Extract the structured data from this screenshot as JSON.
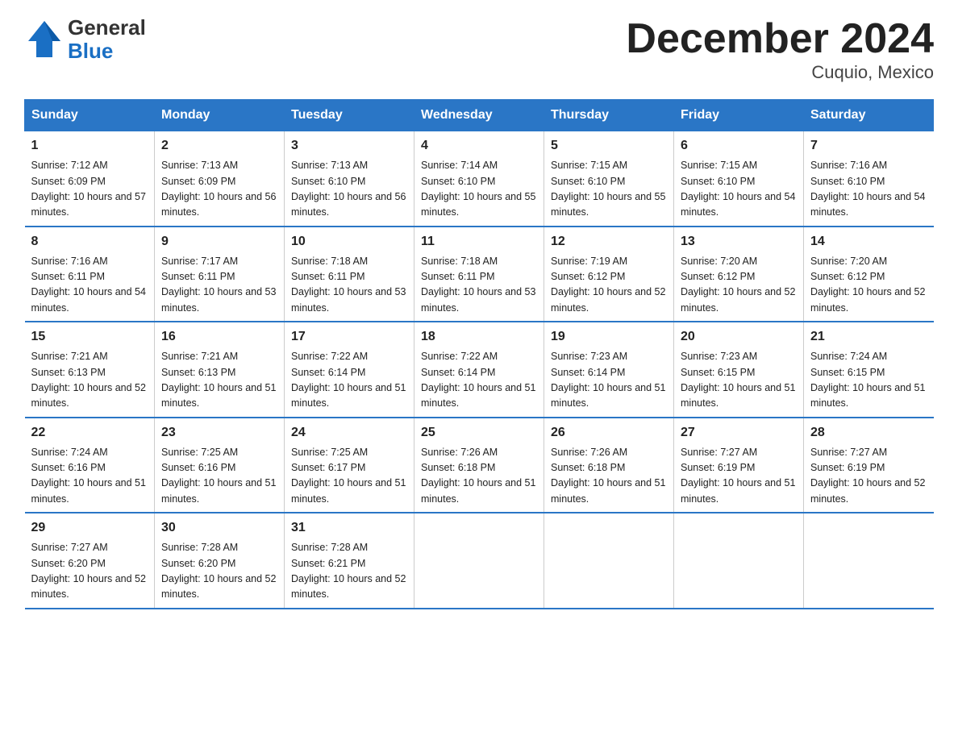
{
  "header": {
    "logo_general": "General",
    "logo_blue": "Blue",
    "title": "December 2024",
    "subtitle": "Cuquio, Mexico"
  },
  "calendar": {
    "days_of_week": [
      "Sunday",
      "Monday",
      "Tuesday",
      "Wednesday",
      "Thursday",
      "Friday",
      "Saturday"
    ],
    "weeks": [
      [
        {
          "day": "1",
          "sunrise": "7:12 AM",
          "sunset": "6:09 PM",
          "daylight": "10 hours and 57 minutes."
        },
        {
          "day": "2",
          "sunrise": "7:13 AM",
          "sunset": "6:09 PM",
          "daylight": "10 hours and 56 minutes."
        },
        {
          "day": "3",
          "sunrise": "7:13 AM",
          "sunset": "6:10 PM",
          "daylight": "10 hours and 56 minutes."
        },
        {
          "day": "4",
          "sunrise": "7:14 AM",
          "sunset": "6:10 PM",
          "daylight": "10 hours and 55 minutes."
        },
        {
          "day": "5",
          "sunrise": "7:15 AM",
          "sunset": "6:10 PM",
          "daylight": "10 hours and 55 minutes."
        },
        {
          "day": "6",
          "sunrise": "7:15 AM",
          "sunset": "6:10 PM",
          "daylight": "10 hours and 54 minutes."
        },
        {
          "day": "7",
          "sunrise": "7:16 AM",
          "sunset": "6:10 PM",
          "daylight": "10 hours and 54 minutes."
        }
      ],
      [
        {
          "day": "8",
          "sunrise": "7:16 AM",
          "sunset": "6:11 PM",
          "daylight": "10 hours and 54 minutes."
        },
        {
          "day": "9",
          "sunrise": "7:17 AM",
          "sunset": "6:11 PM",
          "daylight": "10 hours and 53 minutes."
        },
        {
          "day": "10",
          "sunrise": "7:18 AM",
          "sunset": "6:11 PM",
          "daylight": "10 hours and 53 minutes."
        },
        {
          "day": "11",
          "sunrise": "7:18 AM",
          "sunset": "6:11 PM",
          "daylight": "10 hours and 53 minutes."
        },
        {
          "day": "12",
          "sunrise": "7:19 AM",
          "sunset": "6:12 PM",
          "daylight": "10 hours and 52 minutes."
        },
        {
          "day": "13",
          "sunrise": "7:20 AM",
          "sunset": "6:12 PM",
          "daylight": "10 hours and 52 minutes."
        },
        {
          "day": "14",
          "sunrise": "7:20 AM",
          "sunset": "6:12 PM",
          "daylight": "10 hours and 52 minutes."
        }
      ],
      [
        {
          "day": "15",
          "sunrise": "7:21 AM",
          "sunset": "6:13 PM",
          "daylight": "10 hours and 52 minutes."
        },
        {
          "day": "16",
          "sunrise": "7:21 AM",
          "sunset": "6:13 PM",
          "daylight": "10 hours and 51 minutes."
        },
        {
          "day": "17",
          "sunrise": "7:22 AM",
          "sunset": "6:14 PM",
          "daylight": "10 hours and 51 minutes."
        },
        {
          "day": "18",
          "sunrise": "7:22 AM",
          "sunset": "6:14 PM",
          "daylight": "10 hours and 51 minutes."
        },
        {
          "day": "19",
          "sunrise": "7:23 AM",
          "sunset": "6:14 PM",
          "daylight": "10 hours and 51 minutes."
        },
        {
          "day": "20",
          "sunrise": "7:23 AM",
          "sunset": "6:15 PM",
          "daylight": "10 hours and 51 minutes."
        },
        {
          "day": "21",
          "sunrise": "7:24 AM",
          "sunset": "6:15 PM",
          "daylight": "10 hours and 51 minutes."
        }
      ],
      [
        {
          "day": "22",
          "sunrise": "7:24 AM",
          "sunset": "6:16 PM",
          "daylight": "10 hours and 51 minutes."
        },
        {
          "day": "23",
          "sunrise": "7:25 AM",
          "sunset": "6:16 PM",
          "daylight": "10 hours and 51 minutes."
        },
        {
          "day": "24",
          "sunrise": "7:25 AM",
          "sunset": "6:17 PM",
          "daylight": "10 hours and 51 minutes."
        },
        {
          "day": "25",
          "sunrise": "7:26 AM",
          "sunset": "6:18 PM",
          "daylight": "10 hours and 51 minutes."
        },
        {
          "day": "26",
          "sunrise": "7:26 AM",
          "sunset": "6:18 PM",
          "daylight": "10 hours and 51 minutes."
        },
        {
          "day": "27",
          "sunrise": "7:27 AM",
          "sunset": "6:19 PM",
          "daylight": "10 hours and 51 minutes."
        },
        {
          "day": "28",
          "sunrise": "7:27 AM",
          "sunset": "6:19 PM",
          "daylight": "10 hours and 52 minutes."
        }
      ],
      [
        {
          "day": "29",
          "sunrise": "7:27 AM",
          "sunset": "6:20 PM",
          "daylight": "10 hours and 52 minutes."
        },
        {
          "day": "30",
          "sunrise": "7:28 AM",
          "sunset": "6:20 PM",
          "daylight": "10 hours and 52 minutes."
        },
        {
          "day": "31",
          "sunrise": "7:28 AM",
          "sunset": "6:21 PM",
          "daylight": "10 hours and 52 minutes."
        },
        null,
        null,
        null,
        null
      ]
    ],
    "labels": {
      "sunrise": "Sunrise: ",
      "sunset": "Sunset: ",
      "daylight": "Daylight: "
    }
  }
}
